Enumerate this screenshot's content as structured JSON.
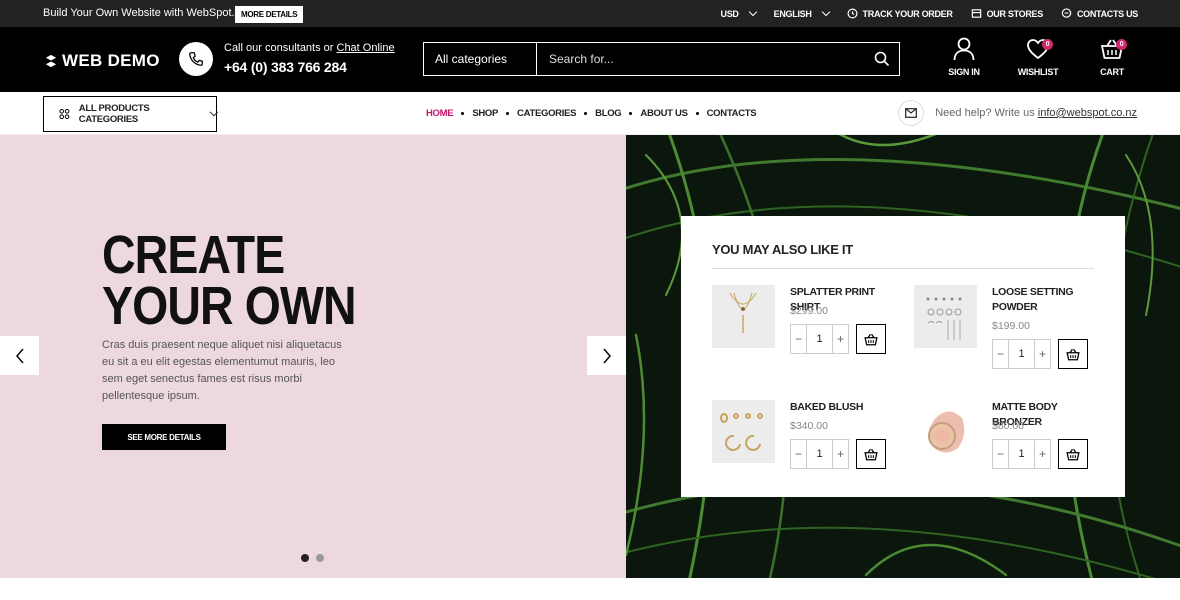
{
  "topbar": {
    "promo": "Build Your Own Website with WebSpot.",
    "promo_button": "MORE DETAILS",
    "currency": "USD",
    "language": "ENGLISH",
    "track": "TRACK YOUR ORDER",
    "stores": "OUR STORES",
    "contacts": "CONTACTS US"
  },
  "header": {
    "logo": "WEB DEMO",
    "consult_text": "Call our consultants or ",
    "consult_link": "Chat Online",
    "phone": "+64 (0) 383 766 284",
    "search_category": "All categories",
    "search_placeholder": "Search for...",
    "signin": "SIGN IN",
    "wishlist": "WISHLIST",
    "wishlist_count": "0",
    "cart": "CART",
    "cart_count": "0"
  },
  "nav": {
    "all_categories": "ALL PRODUCTS CATEGORIES",
    "items": [
      "HOME",
      "SHOP",
      "CATEGORIES",
      "BLOG",
      "ABOUT US",
      "CONTACTS"
    ],
    "active": "HOME",
    "help_text": "Need help? Write us ",
    "help_email": "info@webspot.co.nz"
  },
  "hero": {
    "title_line1": "CREATE",
    "title_line2": "YOUR OWN",
    "description": "Cras duis praesent neque aliquet nisi aliquetacus eu sit a eu elit egestas elementumut mauris, leo sem eget senectus fames est risus morbi pellentesque ipsum.",
    "button": "SEE MORE DETAILS",
    "bg_color": "#ecd8de"
  },
  "panel": {
    "title": "YOU MAY ALSO LIKE IT",
    "products": [
      {
        "name": "SPLATTER PRINT SHIRT",
        "price": "$299.00",
        "qty": "1"
      },
      {
        "name": "LOOSE SETTING POWDER",
        "price": "$199.00",
        "qty": "1"
      },
      {
        "name": "BAKED BLUSH",
        "price": "$340.00",
        "qty": "1"
      },
      {
        "name": "MATTE BODY BRONZER",
        "price": "$80.00",
        "qty": "1"
      }
    ]
  },
  "colors": {
    "accent": "#c4136a",
    "badge": "#d1276d"
  }
}
